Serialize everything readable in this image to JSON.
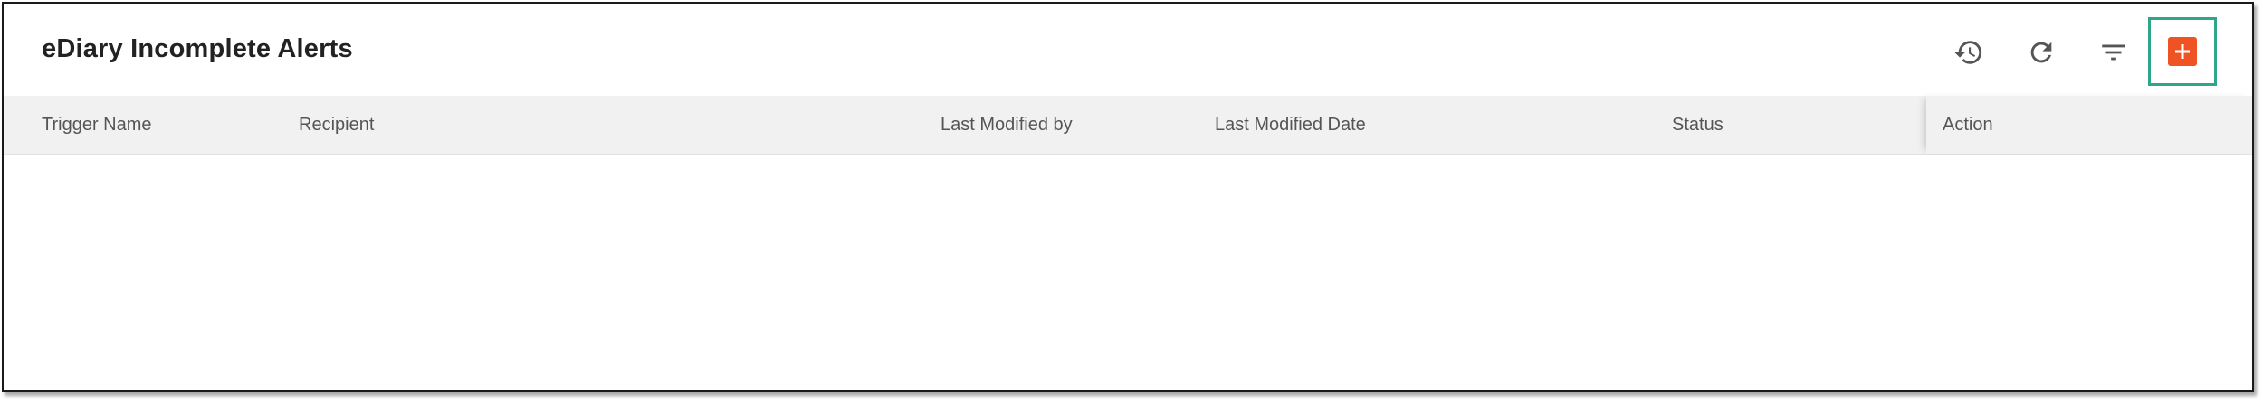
{
  "page": {
    "title": "eDiary Incomplete Alerts"
  },
  "toolbar": {
    "buttons": [
      {
        "name": "history",
        "icon": "history-icon"
      },
      {
        "name": "refresh",
        "icon": "refresh-icon"
      },
      {
        "name": "filter",
        "icon": "filter-icon"
      },
      {
        "name": "add",
        "icon": "plus-icon"
      }
    ],
    "add_color": "#f05323",
    "highlight_color": "#2fa58a",
    "icon_color": "#555555"
  },
  "table": {
    "columns": [
      "Trigger Name",
      "Recipient",
      "Last Modified by",
      "Last Modified Date",
      "Status",
      "Action"
    ],
    "rows": []
  }
}
